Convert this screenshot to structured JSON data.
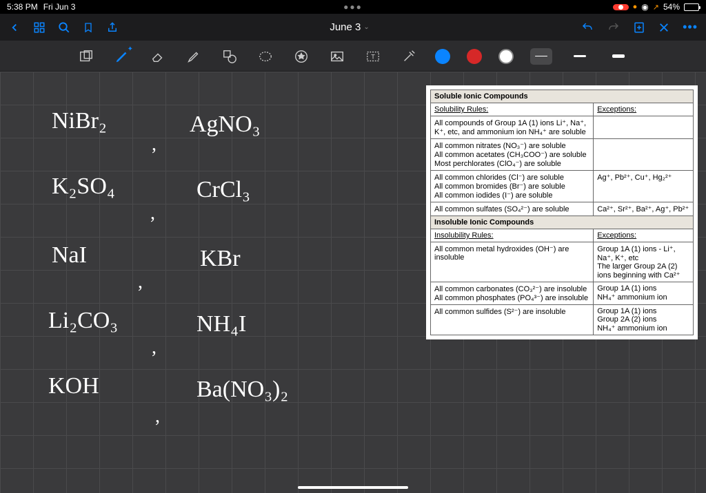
{
  "status": {
    "time": "5:38 PM",
    "date": "Fri Jun 3",
    "battery_pct": "54%",
    "wifi_dot": "●",
    "compass": "⌖"
  },
  "nav": {
    "title": "June 3"
  },
  "colors": {
    "blue": "#0a84ff",
    "red": "#d62828",
    "white": "#ffffff"
  },
  "handwriting": {
    "col1": [
      "NiBr₂",
      "K₂SO₄",
      "NaI",
      "Li₂CO₃",
      "KOH"
    ],
    "col2": [
      "AgNO₃",
      "CrCl₃",
      "KBr",
      "NH₄I",
      "Ba(NO₃)₂"
    ]
  },
  "solubility": {
    "section1_title": "Soluble Ionic Compounds",
    "section1_col1": "Solubility Rules:",
    "section1_col2": "Exceptions:",
    "rows1": [
      {
        "rule": "All compounds of Group 1A (1) ions Li⁺, Na⁺, K⁺, etc, and ammonium ion NH₄⁺ are soluble",
        "exc": ""
      },
      {
        "rule": "All common nitrates (NO₃⁻) are soluble\nAll common acetates (CH₃COO⁻) are soluble\nMost perchlorates (ClO₄⁻) are soluble",
        "exc": ""
      },
      {
        "rule": "All common chlorides (Cl⁻) are soluble\nAll common bromides (Br⁻) are soluble\nAll common iodides (I⁻) are soluble",
        "exc": "Ag⁺, Pb²⁺, Cu⁺, Hg₂²⁺"
      },
      {
        "rule": "All common sulfates (SO₄²⁻) are soluble",
        "exc": "Ca²⁺, Sr²⁺, Ba²⁺, Ag⁺, Pb²⁺"
      }
    ],
    "section2_title": "Insoluble Ionic Compounds",
    "section2_col1": "Insolubility Rules:",
    "section2_col2": "Exceptions:",
    "rows2": [
      {
        "rule": "All common metal hydroxides (OH⁻) are insoluble",
        "exc": "Group 1A (1) ions - Li⁺, Na⁺, K⁺, etc\nThe larger Group 2A (2) ions beginning with Ca²⁺"
      },
      {
        "rule": "All common carbonates (CO₃²⁻) are insoluble\nAll common phosphates (PO₄³⁻) are insoluble",
        "exc": "Group 1A (1) ions\nNH₄⁺ ammonium ion"
      },
      {
        "rule": "All common sulfides (S²⁻) are insoluble",
        "exc": "Group 1A (1) ions\nGroup 2A (2) ions\nNH₄⁺ ammonium ion"
      }
    ]
  }
}
